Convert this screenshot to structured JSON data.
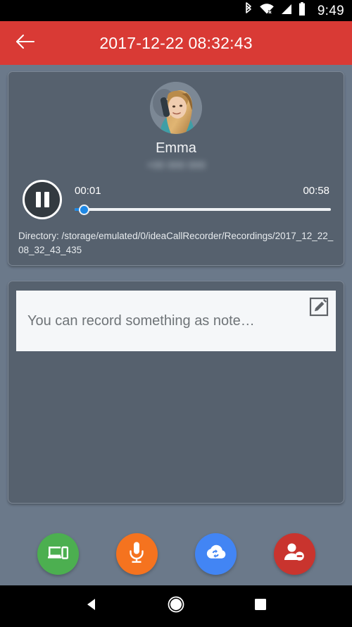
{
  "status_bar": {
    "clock": "9:49",
    "icons": [
      "bluetooth-icon",
      "wifi-no-internet-icon",
      "cellular-signal-icon",
      "battery-icon"
    ]
  },
  "app_bar": {
    "back_icon": "arrow-back-icon",
    "title": "2017-12-22 08:32:43",
    "background_color": "#d93a35"
  },
  "player": {
    "avatar_icon": "contact-photo-avatar",
    "contact_name": "Emma",
    "contact_number": "+00 000 000",
    "play_pause_icon": "pause-icon",
    "current_time": "00:01",
    "total_time": "00:58",
    "progress_percent": 2,
    "seek_accent_color": "#1e88e5",
    "directory_label": "Directory: /storage/emulated/0/ideaCallRecorder/Recordings/2017_12_22_08_32_43_435"
  },
  "note": {
    "placeholder": "You can record something as note…",
    "value": "",
    "edit_icon": "edit-note-icon"
  },
  "actions": [
    {
      "name": "share-to-device-button",
      "icon": "phonelink-devices-icon",
      "color": "#4caf50"
    },
    {
      "name": "record-voice-note-button",
      "icon": "microphone-icon",
      "color": "#f5731f"
    },
    {
      "name": "cloud-sync-button",
      "icon": "cloud-sync-icon",
      "color": "#4285f4"
    },
    {
      "name": "block-contact-button",
      "icon": "person-remove-icon",
      "color": "#c9342e"
    }
  ],
  "nav_bar": {
    "back": "nav-back-icon",
    "home": "nav-home-icon",
    "recents": "nav-recents-icon"
  },
  "theme": {
    "page_background": "#6b798a",
    "card_background": "#56616e",
    "card_border": "#7c8795"
  }
}
